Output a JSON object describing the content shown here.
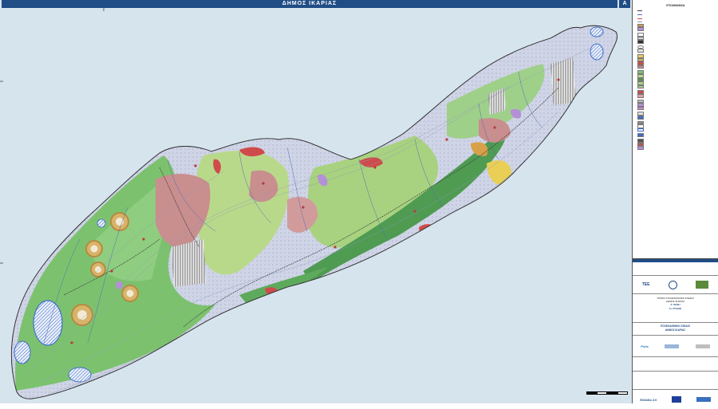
{
  "map": {
    "title": "ΔΗΜΟΣ ΙΚΑΡΙΑΣ",
    "sheet_id": "A"
  },
  "legend": {
    "title": "ΥΠΟΜΝΗΜΑ",
    "colors": {
      "forest": "#7cc26e",
      "light_green": "#b9d98a",
      "dark_green": "#4f9b52",
      "settlement": "#c98e8e",
      "red_zone": "#cf4b4b",
      "purple": "#b590d8",
      "orange": "#d9a04a",
      "blue_hatch": "#3f6dc9",
      "hatch_grey": "#8c8c8c",
      "sea": "#d6e4ee"
    }
  },
  "title_block": {
    "logo_left": "TEE",
    "logo_right": "ΔΗΜΟΣ",
    "project_line1": "ΤΟΠΙΚΟ ΠΟΛΕΟΔΟΜΙΚΟ ΣΧΕΔΙΟ",
    "project_line2": "ΔΗΜΟΣ ΙΚΑΡΙΑΣ",
    "stage": "Α' ΦΑΣΗ",
    "stage_sub": "1ο ΣΤΑΔΙΟ",
    "sheet_line1": "ΠΟΛΕΟΔΟΜΙΚΟ ΣΧΕΔΙΟ",
    "sheet_line2": "ΔΗΜΟΣ ΙΚΑΡΙΑΣ",
    "consultant_logo": "Polis",
    "funding_logo": "Ελλάδα 2.0"
  },
  "scale": {
    "label": "0"
  }
}
